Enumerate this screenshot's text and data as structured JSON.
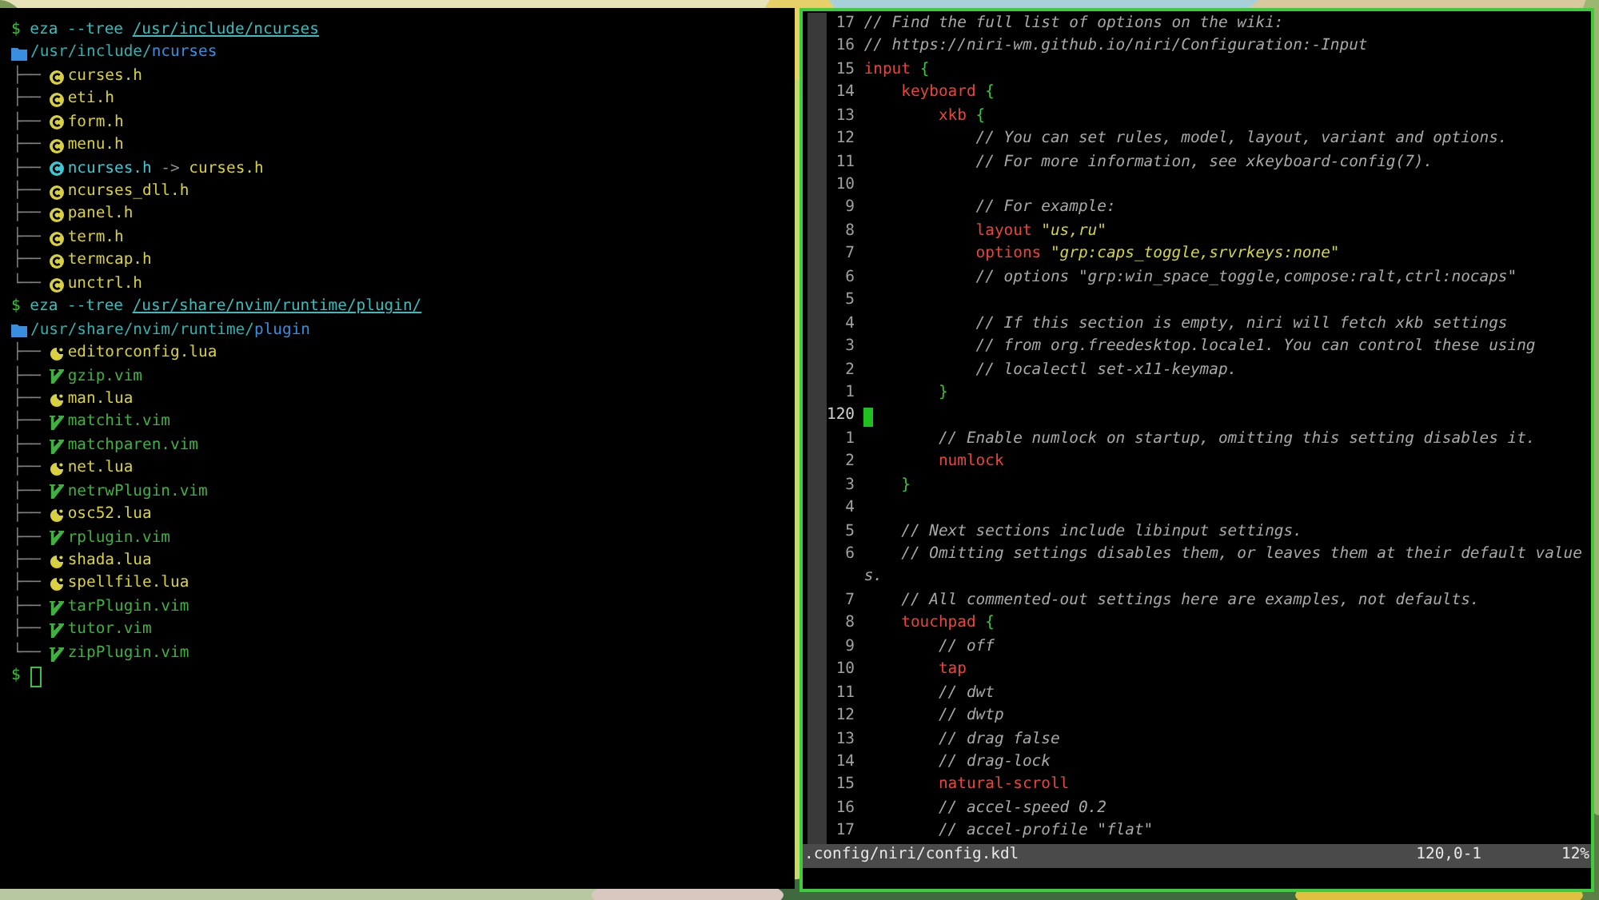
{
  "terminal": {
    "blocks": [
      {
        "prompt": {
          "symbol": "$",
          "command": "eza",
          "flag": "--tree",
          "path": "/usr/include/ncurses"
        },
        "root": {
          "parent": "/usr/include/",
          "name": "ncurses"
        },
        "entries": [
          {
            "branch": "├──",
            "kind": "header",
            "name": "curses.h"
          },
          {
            "branch": "├──",
            "kind": "header",
            "name": "eti.h"
          },
          {
            "branch": "├──",
            "kind": "header",
            "name": "form.h"
          },
          {
            "branch": "├──",
            "kind": "header",
            "name": "menu.h"
          },
          {
            "branch": "├──",
            "kind": "link",
            "name": "ncurses.h",
            "arrow": "->",
            "target": "curses.h"
          },
          {
            "branch": "├──",
            "kind": "header",
            "name": "ncurses_dll.h"
          },
          {
            "branch": "├──",
            "kind": "header",
            "name": "panel.h"
          },
          {
            "branch": "├──",
            "kind": "header",
            "name": "term.h"
          },
          {
            "branch": "├──",
            "kind": "header",
            "name": "termcap.h"
          },
          {
            "branch": "└──",
            "kind": "header",
            "name": "unctrl.h"
          }
        ]
      },
      {
        "prompt": {
          "symbol": "$",
          "command": "eza",
          "flag": "--tree",
          "path": "/usr/share/nvim/runtime/plugin/"
        },
        "root": {
          "parent": "/usr/share/nvim/runtime/",
          "name": "plugin"
        },
        "entries": [
          {
            "branch": "├──",
            "kind": "lua",
            "name": "editorconfig.lua"
          },
          {
            "branch": "├──",
            "kind": "vim",
            "name": "gzip.vim"
          },
          {
            "branch": "├──",
            "kind": "lua",
            "name": "man.lua"
          },
          {
            "branch": "├──",
            "kind": "vim",
            "name": "matchit.vim"
          },
          {
            "branch": "├──",
            "kind": "vim",
            "name": "matchparen.vim"
          },
          {
            "branch": "├──",
            "kind": "lua",
            "name": "net.lua"
          },
          {
            "branch": "├──",
            "kind": "vim",
            "name": "netrwPlugin.vim"
          },
          {
            "branch": "├──",
            "kind": "lua",
            "name": "osc52.lua"
          },
          {
            "branch": "├──",
            "kind": "vim",
            "name": "rplugin.vim"
          },
          {
            "branch": "├──",
            "kind": "lua",
            "name": "shada.lua"
          },
          {
            "branch": "├──",
            "kind": "lua",
            "name": "spellfile.lua"
          },
          {
            "branch": "├──",
            "kind": "vim",
            "name": "tarPlugin.vim"
          },
          {
            "branch": "├──",
            "kind": "vim",
            "name": "tutor.vim"
          },
          {
            "branch": "└──",
            "kind": "vim",
            "name": "zipPlugin.vim"
          }
        ]
      }
    ],
    "final_prompt": {
      "symbol": "$"
    }
  },
  "editor": {
    "lines": [
      {
        "number": "17",
        "current": false,
        "segments": [
          {
            "kind": "comment",
            "text": "// Find the full list of options on the wiki:"
          }
        ]
      },
      {
        "number": "16",
        "current": false,
        "segments": [
          {
            "kind": "comment",
            "text": "// https://niri-wm.github.io/niri/Configuration:-Input"
          }
        ]
      },
      {
        "number": "15",
        "current": false,
        "segments": [
          {
            "kind": "keyword",
            "text": "input"
          },
          {
            "kind": "brace",
            "text": "{"
          }
        ],
        "children": [
          {
            "number": "14",
            "current": false,
            "segments": [
              {
                "kind": "keyword",
                "text": "keyboard"
              },
              {
                "kind": "brace",
                "text": "{"
              }
            ],
            "children": [
              {
                "number": "13",
                "current": false,
                "segments": [
                  {
                    "kind": "keyword",
                    "text": "xkb"
                  },
                  {
                    "kind": "brace",
                    "text": "{"
                  }
                ],
                "children": [
                  {
                    "number": "12",
                    "current": false,
                    "segments": [
                      {
                        "kind": "comment",
                        "text": "// You can set rules, model, layout, variant and options."
                      }
                    ]
                  },
                  {
                    "number": "11",
                    "current": false,
                    "segments": [
                      {
                        "kind": "comment",
                        "text": "// For more information, see xkeyboard-config(7)."
                      }
                    ]
                  },
                  {
                    "number": "10",
                    "current": false
                  },
                  {
                    "number": "9",
                    "current": false,
                    "segments": [
                      {
                        "kind": "comment",
                        "text": "// For example:"
                      }
                    ]
                  },
                  {
                    "number": "8",
                    "current": false,
                    "segments": [
                      {
                        "kind": "keyword",
                        "text": "layout"
                      },
                      {
                        "kind": "string",
                        "text": "\"us,ru\""
                      }
                    ]
                  },
                  {
                    "number": "7",
                    "current": false,
                    "segments": [
                      {
                        "kind": "keyword",
                        "text": "options"
                      },
                      {
                        "kind": "string",
                        "text": "\"grp:caps_toggle,srvrkeys:none\""
                      }
                    ]
                  },
                  {
                    "number": "6",
                    "current": false,
                    "segments": [
                      {
                        "kind": "comment",
                        "text": "// options \"grp:win_space_toggle,compose:ralt,ctrl:nocaps\""
                      }
                    ]
                  },
                  {
                    "number": "5",
                    "current": false
                  },
                  {
                    "number": "4",
                    "current": false,
                    "segments": [
                      {
                        "kind": "comment",
                        "text": "// If this section is empty, niri will fetch xkb settings"
                      }
                    ]
                  },
                  {
                    "number": "3",
                    "current": false,
                    "segments": [
                      {
                        "kind": "comment",
                        "text": "// from org.freedesktop.locale1. You can control these using"
                      }
                    ]
                  },
                  {
                    "number": "2",
                    "current": false,
                    "segments": [
                      {
                        "kind": "comment",
                        "text": "// localectl set-x11-keymap."
                      }
                    ]
                  }
                ]
              },
              {
                "number": "1",
                "current": false,
                "segments": [
                  {
                    "kind": "brace",
                    "text": "}"
                  }
                ]
              },
              {
                "number": "120",
                "current": true
              },
              {
                "number": "1",
                "current": false,
                "segments": [
                  {
                    "kind": "comment",
                    "text": "// Enable numlock on startup, omitting this setting disables it."
                  }
                ]
              },
              {
                "number": "2",
                "current": false,
                "segments": [
                  {
                    "kind": "keyword",
                    "text": "numlock"
                  }
                ]
              }
            ]
          },
          {
            "number": "3",
            "current": false,
            "segments": [
              {
                "kind": "brace",
                "text": "}"
              }
            ]
          },
          {
            "number": "4",
            "current": false
          },
          {
            "number": "5",
            "current": false,
            "segments": [
              {
                "kind": "comment",
                "text": "// Next sections include libinput settings."
              }
            ]
          },
          {
            "number": "6",
            "current": false,
            "segments": [
              {
                "kind": "comment",
                "text": "// Omitting settings disables them, or leaves them at their default value"
              }
            ],
            "wrap": "s."
          },
          {
            "number": "7",
            "current": false,
            "segments": [
              {
                "kind": "comment",
                "text": "// All commented-out settings here are examples, not defaults."
              }
            ]
          },
          {
            "number": "8",
            "current": false,
            "segments": [
              {
                "kind": "keyword",
                "text": "touchpad"
              },
              {
                "kind": "brace",
                "text": "{"
              }
            ],
            "children": [
              {
                "number": "9",
                "current": false,
                "segments": [
                  {
                    "kind": "comment",
                    "text": "// off"
                  }
                ]
              },
              {
                "number": "10",
                "current": false,
                "segments": [
                  {
                    "kind": "keyword",
                    "text": "tap"
                  }
                ]
              },
              {
                "number": "11",
                "current": false,
                "segments": [
                  {
                    "kind": "comment",
                    "text": "// dwt"
                  }
                ]
              },
              {
                "number": "12",
                "current": false,
                "segments": [
                  {
                    "kind": "comment",
                    "text": "// dwtp"
                  }
                ]
              },
              {
                "number": "13",
                "current": false,
                "segments": [
                  {
                    "kind": "comment",
                    "text": "// drag false"
                  }
                ]
              },
              {
                "number": "14",
                "current": false,
                "segments": [
                  {
                    "kind": "comment",
                    "text": "// drag-lock"
                  }
                ]
              },
              {
                "number": "15",
                "current": false,
                "segments": [
                  {
                    "kind": "keyword",
                    "text": "natural-scroll"
                  }
                ]
              },
              {
                "number": "16",
                "current": false,
                "segments": [
                  {
                    "kind": "comment",
                    "text": "// accel-speed 0.2"
                  }
                ]
              },
              {
                "number": "17",
                "current": false,
                "segments": [
                  {
                    "kind": "comment",
                    "text": "// accel-profile \"flat\""
                  }
                ]
              }
            ]
          }
        ]
      }
    ],
    "status_bar": {
      "file": ".config/niri/config.kdl",
      "position": "120,0-1",
      "percent": "12%"
    }
  }
}
